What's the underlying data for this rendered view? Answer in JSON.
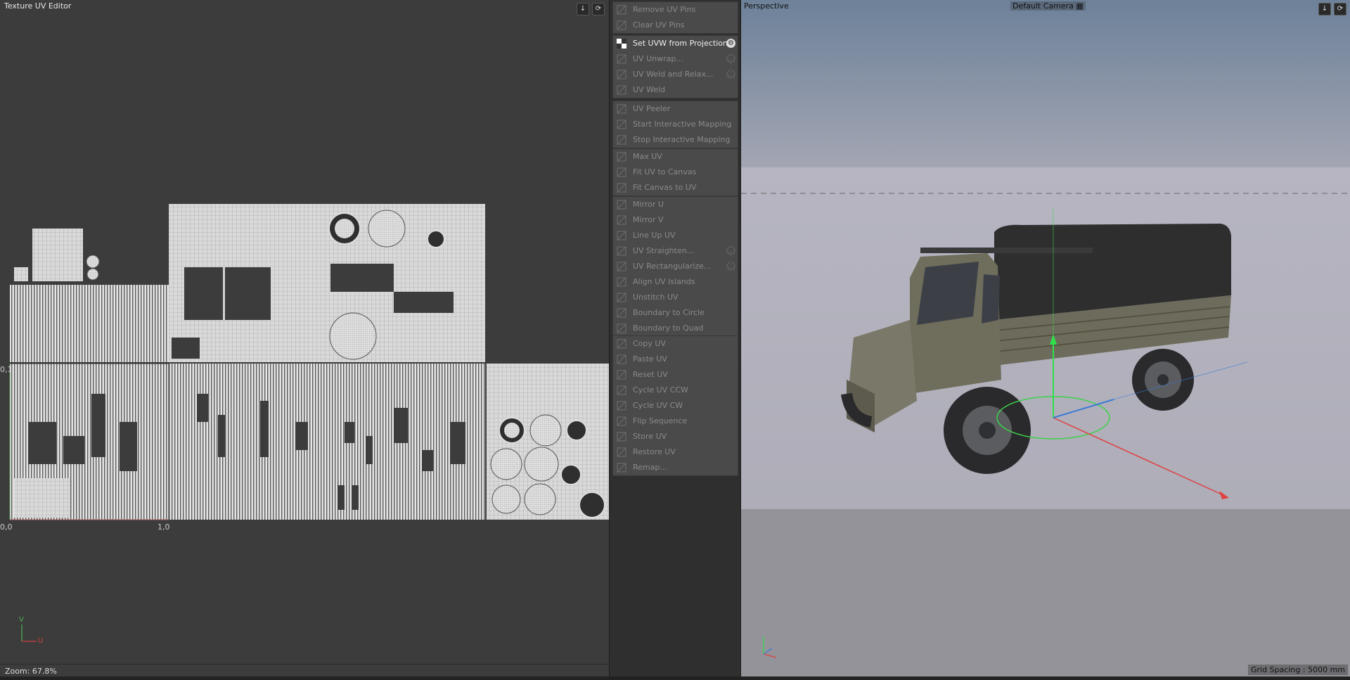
{
  "uv_editor": {
    "title": "Texture UV Editor",
    "corner_label_01": "0,1",
    "corner_label_00": "0,0",
    "corner_label_10": "1,0",
    "axis_v": "V",
    "axis_u": "U",
    "zoom": "Zoom: 67.8%"
  },
  "commands": {
    "group1": [
      {
        "label": "Remove UV Pins",
        "gear": false
      },
      {
        "label": "Clear UV Pins",
        "gear": false
      }
    ],
    "group2": [
      {
        "label": "Set UVW from Projection...",
        "gear": true,
        "active": true
      },
      {
        "label": "UV Unwrap...",
        "gear": true
      },
      {
        "label": "UV Weld and Relax...",
        "gear": true
      },
      {
        "label": "UV Weld",
        "gear": false
      }
    ],
    "group3": [
      {
        "label": "UV Peeler",
        "gear": false
      },
      {
        "label": "Start Interactive Mapping",
        "gear": false
      },
      {
        "label": "Stop Interactive Mapping",
        "gear": false
      }
    ],
    "group4": [
      {
        "label": "Max UV",
        "gear": false
      },
      {
        "label": "Fit UV to Canvas",
        "gear": false
      },
      {
        "label": "Fit Canvas to UV",
        "gear": false
      }
    ],
    "group5": [
      {
        "label": "Mirror U",
        "gear": false
      },
      {
        "label": "Mirror V",
        "gear": false
      },
      {
        "label": "Line Up UV",
        "gear": false
      },
      {
        "label": "UV Straighten...",
        "gear": true
      },
      {
        "label": "UV Rectangularize...",
        "gear": true
      },
      {
        "label": "Align UV Islands",
        "gear": false
      },
      {
        "label": "Unstitch UV",
        "gear": false
      },
      {
        "label": "Boundary to Circle",
        "gear": false
      },
      {
        "label": "Boundary to Quad",
        "gear": false
      }
    ],
    "group6": [
      {
        "label": "Copy UV",
        "gear": false
      },
      {
        "label": "Paste UV",
        "gear": false
      },
      {
        "label": "Reset UV",
        "gear": false
      },
      {
        "label": "Cycle UV CCW",
        "gear": false
      },
      {
        "label": "Cycle UV CW",
        "gear": false
      },
      {
        "label": "Flip Sequence",
        "gear": false
      },
      {
        "label": "Store UV",
        "gear": false
      },
      {
        "label": "Restore UV",
        "gear": false
      },
      {
        "label": "Remap...",
        "gear": false
      }
    ]
  },
  "viewport": {
    "title": "Perspective",
    "camera": "Default Camera",
    "grid_spacing": "Grid Spacing : 5000 mm"
  },
  "colors": {
    "uv_bg": "#3c3c3c",
    "panel_bg": "#4a4a4a",
    "sky_top": "#6d8199",
    "floor": "#b8b6c0"
  }
}
